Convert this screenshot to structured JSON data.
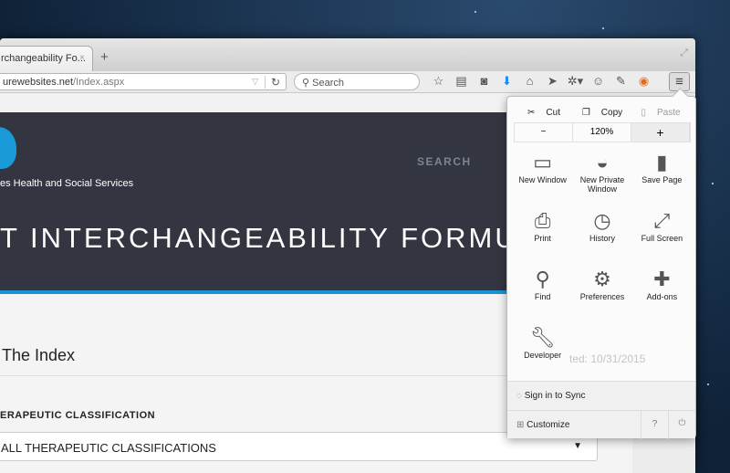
{
  "tab": {
    "title": "rchangeability Fo...",
    "close": "×",
    "new_tab": "+"
  },
  "toolbar": {
    "url_host": "urewebsites.net",
    "url_path": "/Index.aspx",
    "search_placeholder": "Search"
  },
  "page": {
    "brand": "es  Health and Social Services",
    "nav_search": "SEARCH",
    "title": "T INTERCHANGEABILITY FORMULAR",
    "index_heading": "The Index",
    "classification_label": "ERAPEUTIC CLASSIFICATION",
    "classification_value": "ALL THERAPEUTIC CLASSIFICATIONS",
    "ghost_text": "ted: 10/31/2015"
  },
  "menu": {
    "cut": "Cut",
    "copy": "Copy",
    "paste": "Paste",
    "zoom_out": "−",
    "zoom_level": "120%",
    "zoom_in": "+",
    "items": [
      {
        "label": "New Window",
        "icon": "window-icon"
      },
      {
        "label": "New Private Window",
        "icon": "mask-icon"
      },
      {
        "label": "Save Page",
        "icon": "page-icon"
      },
      {
        "label": "Print",
        "icon": "printer-icon"
      },
      {
        "label": "History",
        "icon": "clock-icon"
      },
      {
        "label": "Full Screen",
        "icon": "fullscreen-icon"
      },
      {
        "label": "Find",
        "icon": "magnifier-icon"
      },
      {
        "label": "Preferences",
        "icon": "gear-icon"
      },
      {
        "label": "Add-ons",
        "icon": "puzzle-icon"
      },
      {
        "label": "Developer",
        "icon": "wrench-icon"
      }
    ],
    "sync": "Sign in to Sync",
    "customize": "Customize"
  },
  "colors": {
    "header_bg": "#333540",
    "accent": "#1b93d4",
    "download": "#1a8cff"
  }
}
